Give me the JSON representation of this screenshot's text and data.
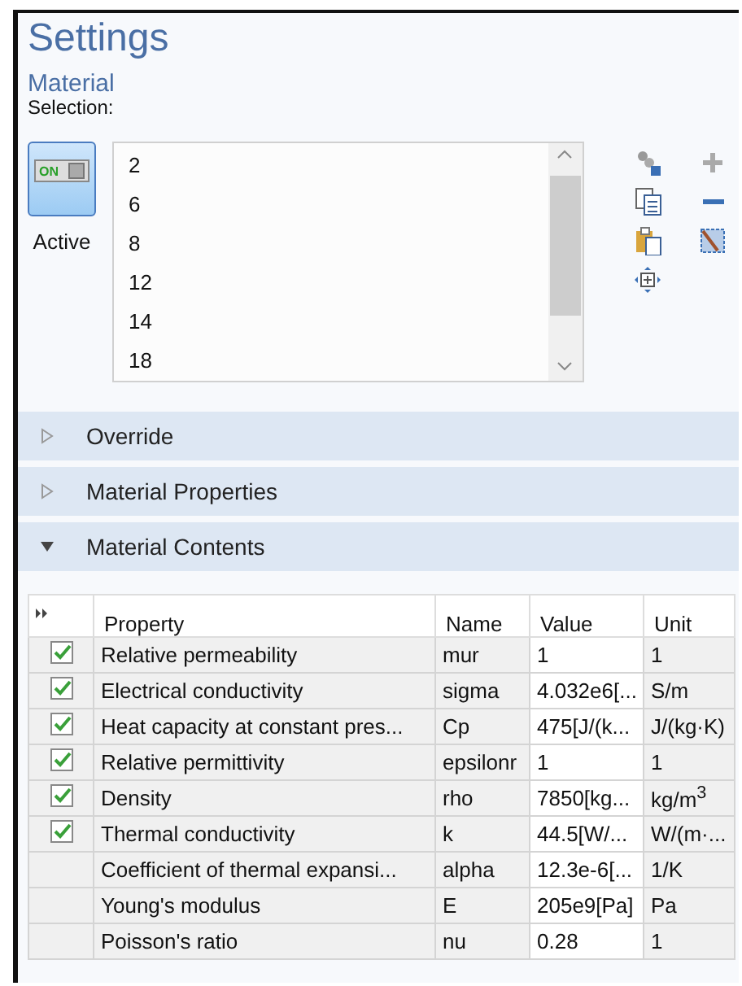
{
  "title": "Settings",
  "subtitle": "Material",
  "selection": {
    "label": "Selection:",
    "toggle": {
      "text": "ON",
      "on": true
    },
    "toggle_label": "Active",
    "items": [
      "2",
      "6",
      "8",
      "12",
      "14",
      "18"
    ]
  },
  "sections": [
    {
      "label": "Override",
      "expanded": false
    },
    {
      "label": "Material Properties",
      "expanded": false
    },
    {
      "label": "Material Contents",
      "expanded": true
    }
  ],
  "table": {
    "columns": [
      "Property",
      "Name",
      "Value",
      "Unit"
    ],
    "rows": [
      {
        "checked": true,
        "property": "Relative permeability",
        "name": "mur",
        "value": "1",
        "unit": "1"
      },
      {
        "checked": true,
        "property": "Electrical conductivity",
        "name": "sigma",
        "value": "4.032e6[...",
        "unit": "S/m"
      },
      {
        "checked": true,
        "property": "Heat capacity at constant pres...",
        "name": "Cp",
        "value": "475[J/(k...",
        "unit": "J/(kg·K)"
      },
      {
        "checked": true,
        "property": "Relative permittivity",
        "name": "epsilonr",
        "value": "1",
        "unit": "1"
      },
      {
        "checked": true,
        "property": "Density",
        "name": "rho",
        "value": "7850[kg...",
        "unit": "kg/m$^{3}$"
      },
      {
        "checked": true,
        "property": "Thermal conductivity",
        "name": "k",
        "value": "44.5[W/...",
        "unit": "W/(m·..."
      },
      {
        "checked": false,
        "property": "Coefficient of thermal expansi...",
        "name": "alpha",
        "value": "12.3e-6[...",
        "unit": "1/K"
      },
      {
        "checked": false,
        "property": "Young's modulus",
        "name": "E",
        "value": "205e9[Pa]",
        "unit": "Pa"
      },
      {
        "checked": false,
        "property": "Poisson's ratio",
        "name": "nu",
        "value": "0.28",
        "unit": "1"
      }
    ]
  }
}
